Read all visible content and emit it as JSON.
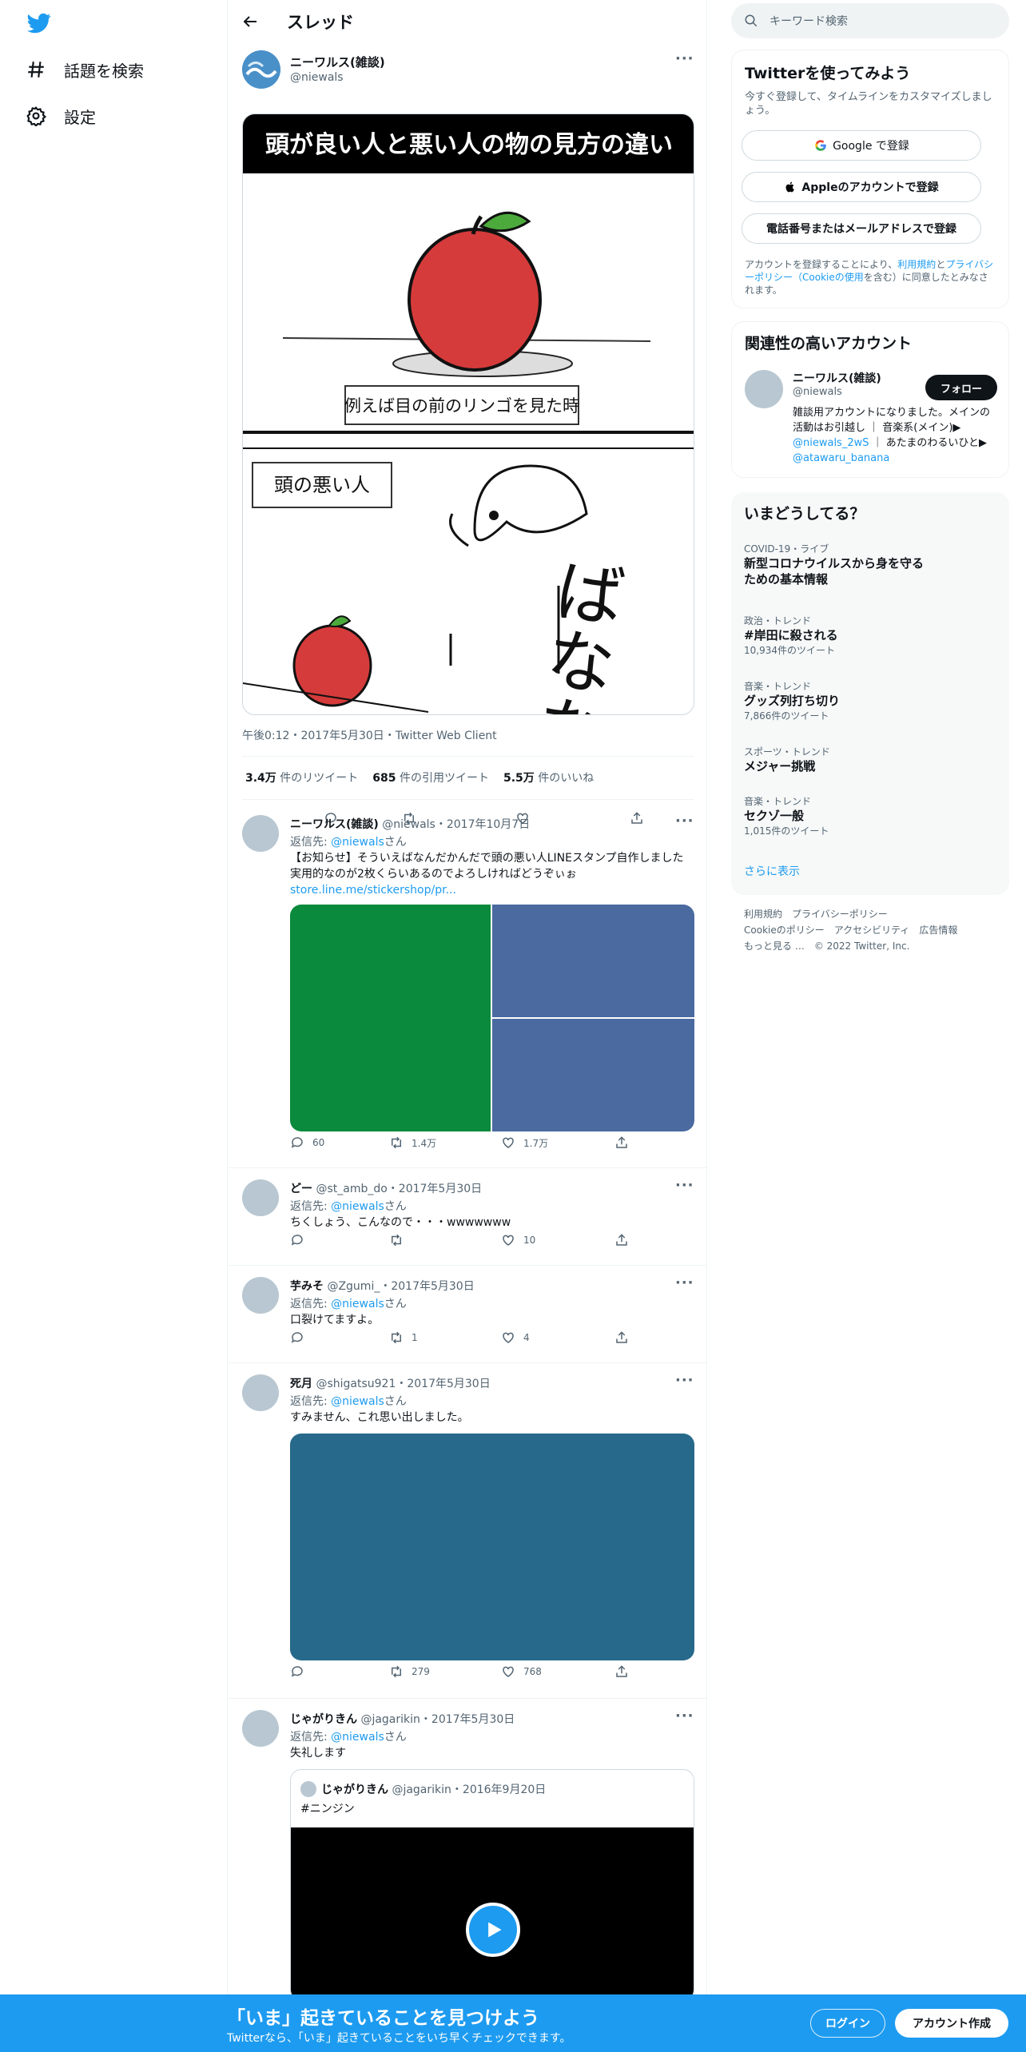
{
  "nav": {
    "logo": "twitter-bird",
    "items": [
      {
        "label": "話題を検索",
        "icon": "hashtag-icon"
      },
      {
        "label": "設定",
        "icon": "gear-icon"
      }
    ]
  },
  "header": {
    "title": "スレッド"
  },
  "main_tweet": {
    "name": "ニーワルス(雑談)",
    "handle": "@niewals",
    "image": {
      "banner": "頭が良い人と悪い人の物の見方の違い",
      "caption": "例えば目の前のリンゴを見た時",
      "panel_label": "頭の悪い人",
      "handwriting": "ばなな"
    },
    "meta": "午後0:12・2017年5月30日・Twitter Web Client",
    "stats": {
      "retweets": "3.4万",
      "retweets_label": "件のリツイート",
      "quotes": "685",
      "quotes_label": "件の引用ツイート",
      "likes": "5.5万",
      "likes_label": "件のいいね"
    }
  },
  "replies": [
    {
      "name": "ニーワルス(雑談)",
      "handle": "@niewals",
      "date": "・2017年10月7日",
      "reply_to_prefix": "返信先: ",
      "reply_to": "@niewals",
      "reply_to_suffix": "さん",
      "text": "【お知らせ】そういえばなんだかんだで頭の悪い人LINEスタンプ自作しました　実用的なのが2枚くらいあるのでよろしければどうぞぃぉ",
      "link": "store.line.me/stickershop/pr...",
      "media_colors": [
        "#0a8a3c",
        "#4a6aa0",
        "#4a6aa0"
      ],
      "replies": "60",
      "retweets": "1.4万",
      "likes": "1.7万"
    },
    {
      "name": "どー",
      "handle": "@st_amb_do",
      "date": "・2017年5月30日",
      "reply_to_prefix": "返信先: ",
      "reply_to": "@niewals",
      "reply_to_suffix": "さん",
      "text": "ちくしょう、こんなので・・・wwwwwww",
      "replies": "",
      "retweets": "",
      "likes": "10"
    },
    {
      "name": "芋みそ",
      "handle": "@Zgumi_",
      "date": "・2017年5月30日",
      "reply_to_prefix": "返信先: ",
      "reply_to": "@niewals",
      "reply_to_suffix": "さん",
      "text": "口裂けてますよ。",
      "replies": "",
      "retweets": "1",
      "likes": "4"
    },
    {
      "name": "死月",
      "handle": "@shigatsu921",
      "date": "・2017年5月30日",
      "reply_to_prefix": "返信先: ",
      "reply_to": "@niewals",
      "reply_to_suffix": "さん",
      "text": "すみません、これ思い出しました。",
      "media_color": "#27698b",
      "replies": "",
      "retweets": "279",
      "likes": "768"
    },
    {
      "name": "じゃがりきん",
      "handle": "@jagarikin",
      "date": "・2017年5月30日",
      "reply_to_prefix": "返信先: ",
      "reply_to": "@niewals",
      "reply_to_suffix": "さん",
      "text": "失礼します",
      "quote": {
        "name": "じゃがりきん",
        "handle": "@jagarikin",
        "date": "・2016年9月20日",
        "text": "#ニンジン"
      }
    }
  ],
  "right": {
    "search_placeholder": "キーワード検索",
    "signup": {
      "title": "Twitterを使ってみよう",
      "sub": "今すぐ登録して、タイムラインをカスタマイズしましょう。",
      "google": "Google で登録",
      "apple": "Appleのアカウントで登録",
      "phone": "電話番号またはメールアドレスで登録",
      "legal_1": "アカウントを登録することにより、",
      "legal_terms": "利用規約",
      "legal_2": "と",
      "legal_privacy": "プライバシーポリシー（Cookieの使用",
      "legal_3": "を含む）に同意したとみなされます。"
    },
    "related": {
      "title": "関連性の高いアカウント",
      "name": "ニーワルス(雑談)",
      "handle": "@niewals",
      "follow": "フォロー",
      "bio_1": "雑談用アカウントになりました。メインの活動はお引越し ｜ 音楽系(メイン)▶ ",
      "bio_link1": "@niewals_2wS",
      "bio_2": " ｜ あたまのわるいひと▶ ",
      "bio_link2": "@atawaru_banana"
    },
    "trends": {
      "title": "いまどうしてる？",
      "items": [
        {
          "cat": "COVID-19・ライブ",
          "title": "新型コロナウイルスから身を守るための基本情報",
          "count": ""
        },
        {
          "cat": "政治・トレンド",
          "title": "#岸田に殺される",
          "count": "10,934件のツイート"
        },
        {
          "cat": "音楽・トレンド",
          "title": "グッズ列打ち切り",
          "count": "7,866件のツイート"
        },
        {
          "cat": "スポーツ・トレンド",
          "title": "メジャー挑戦",
          "count": ""
        },
        {
          "cat": "音楽・トレンド",
          "title": "セクゾ一般",
          "count": "1,015件のツイート"
        }
      ],
      "more": "さらに表示"
    },
    "footer": {
      "l1": "利用規約　プライバシーポリシー",
      "l2": "Cookieのポリシー　アクセシビリティ　広告情報",
      "l3": "もっと見る …　© 2022 Twitter, Inc."
    }
  },
  "bottombar": {
    "title": "「いま」起きていることを見つけよう",
    "sub": "Twitterなら、「いま」起きていることをいち早くチェックできます。",
    "login": "ログイン",
    "signup": "アカウント作成"
  },
  "colors": {
    "accent": "#1d9bf0",
    "text": "#0f1419",
    "muted": "#536471"
  }
}
